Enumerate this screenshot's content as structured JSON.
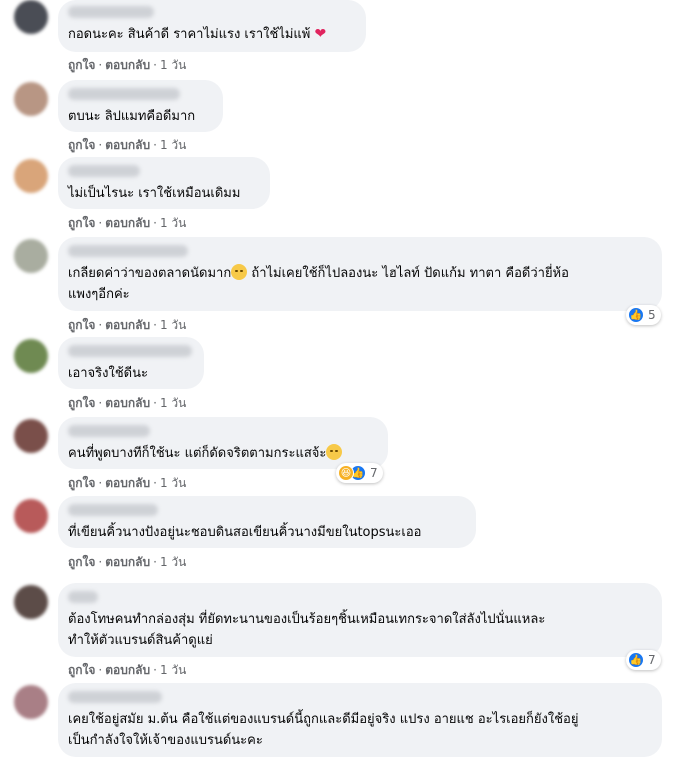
{
  "actions": {
    "like": "ถูกใจ",
    "reply": "ตอบกลับ",
    "time": "1 วัน",
    "sep": "·"
  },
  "colors": {
    "like_blue": "#1877f2",
    "bubble_bg": "#f0f2f5",
    "meta_text": "#65676b",
    "heart": "#e0245e"
  },
  "comments": [
    {
      "lines": [
        "กอดนะคะ สินค้าดี ราคาไม่แรง เราใช้ไม่แพ้"
      ],
      "trailing_icon": "red-heart-emoji-icon"
    },
    {
      "lines": [
        "ตบนะ ลิปแมทคือดีมาก"
      ]
    },
    {
      "lines": [
        "ไม่เป็นไรนะ เราใช้เหมือนเดิมม"
      ]
    },
    {
      "lines": [
        "เกลียดค่าว่าของตลาดนัดมาก",
        " ถ้าไม่เคยใช้ก็ไปลองนะ ไฮไลท์ ปัดแก้ม ทาตา คือดีว่ายี่ห้อ",
        "แพงๆอีกค่ะ"
      ],
      "inline_icon": "sad-face-emoji-icon",
      "reactions": {
        "icons": [
          "like-icon"
        ],
        "count": "5"
      }
    },
    {
      "lines": [
        "เอาจริงใช้ดีนะ"
      ]
    },
    {
      "lines": [
        "คนที่พูดบางทีก็ใช้นะ แต่ก็ดัดจริตตามกระแสจ้ะ"
      ],
      "trailing_icon": "grin-emoji-icon",
      "reactions": {
        "icons": [
          "haha-icon",
          "like-icon"
        ],
        "count": "7"
      }
    },
    {
      "lines": [
        "ที่เขียนคิ้วนางปังอยู่นะชอบดินสอเขียนคิ้วนางมีขยในtopsนะเออ"
      ]
    },
    {
      "lines": [
        "ต้องโทษคนทำกล่องสุ่ม ที่ยัดทะนานของเป็นร้อยๆชิ้นเหมือนเทกระจาดใส่ลังไปนั่นแหละ",
        "ทำให้ตัวแบรนด์สินค้าดูแย่"
      ],
      "reactions": {
        "icons": [
          "like-icon"
        ],
        "count": "7"
      }
    },
    {
      "lines": [
        "เคยใช้อยู่สมัย ม.ต้น คือใช้แต่ของแบรนด์นี้ถูกและดีมีอยู่จริง แปรง อายแช อะไรเอยก็ยังใช้อยู่",
        "เป็นกำลังใจให้เจ้าของแบรนด์นะคะ"
      ]
    }
  ]
}
